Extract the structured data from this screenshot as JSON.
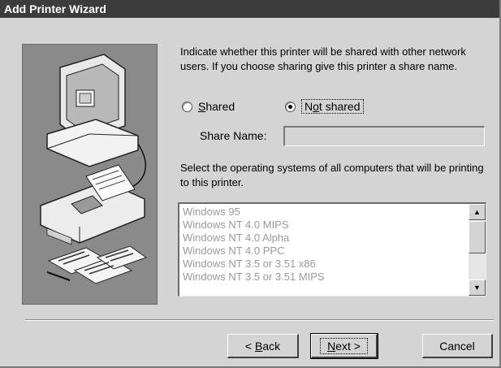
{
  "window": {
    "title": "Add Printer Wizard"
  },
  "intro_text": "Indicate whether this printer will be shared with other network users.  If you choose sharing give this printer a share name.",
  "sharing": {
    "shared_label_mnemonic": "S",
    "shared_label_rest": "hared",
    "not_shared_label_pre": "N",
    "not_shared_label_mnemonic": "o",
    "not_shared_label_rest": "t shared",
    "selected": "not_shared"
  },
  "share_name": {
    "label": "Share Name:",
    "value": ""
  },
  "os_prompt": "Select the operating systems of all computers that will be printing to this printer.",
  "os_list": [
    "Windows 95",
    "Windows NT 4.0 MIPS",
    "Windows NT 4.0 Alpha",
    "Windows NT 4.0 PPC",
    "Windows NT 3.5 or 3.51 x86",
    "Windows NT 3.5 or 3.51 MIPS"
  ],
  "scroll_arrows": {
    "up": "▲",
    "down": "▼"
  },
  "buttons": {
    "back_prefix": "< ",
    "back_mnemonic": "B",
    "back_rest": "ack",
    "next_mnemonic": "N",
    "next_rest": "ext >",
    "cancel": "Cancel"
  },
  "icons": [
    "computer-icon",
    "printer-icon",
    "printed-pages-icon"
  ]
}
